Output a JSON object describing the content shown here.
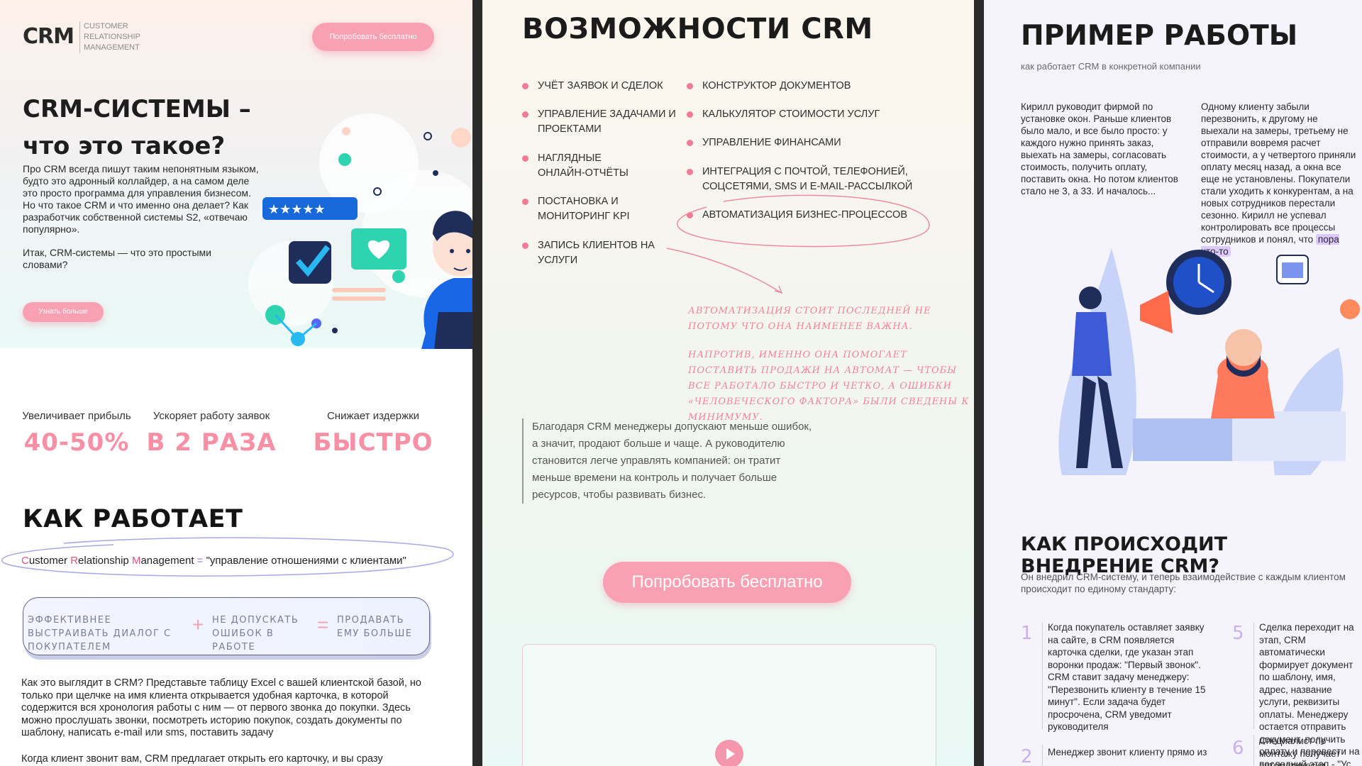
{
  "panel1": {
    "logo": "CRM",
    "logo_sub": "CUSTOMER RELATIONSHIP MANAGEMENT",
    "header_button": "Попробовать бесплатно",
    "hero_title_line1": "CRM-СИСТЕМЫ –",
    "hero_title_line2": "что это такое?",
    "intro": "Про CRM всегда пишут таким непонятным языком, будто это адронный коллайдер, а на самом деле это просто программа для управления бизнесом. Но что такое CRM и что именно она делает? Как разработчик собственной системы S2, «отвечаю популярно».",
    "intro2": "Итак, CRM-системы — что это простыми словами?",
    "more_button": "Узнать больше",
    "stats": [
      {
        "label": "Увеличивает прибыль",
        "value": "40-50%"
      },
      {
        "label": "Ускоряет работу заявок",
        "value": "В 2 РАЗА"
      },
      {
        "label": "Снижает издержки",
        "value": "БЫСТРО"
      }
    ],
    "how_title": "КАК РАБОТАЕТ",
    "crm_def": {
      "c": "C",
      "c_rest": "ustomer ",
      "r": "R",
      "r_rest": "elationship ",
      "m": "M",
      "m_rest": "anagement",
      "eq": " = ",
      "meaning": "\"управление отношениями с клиентами\""
    },
    "formula": {
      "a": "ЭФФЕКТИВНЕЕ ВЫСТРАИВАТЬ ДИАЛОГ С ПОКУПАТЕЛЕМ",
      "plus": "+",
      "b": "НЕ ДОПУСКАТЬ ОШИБОК В РАБОТЕ",
      "eq": "=",
      "c": "ПРОДАВАТЬ ЕМУ БОЛЬШЕ"
    },
    "para1": "Как это выглядит в CRM? Представьте таблицу Excel с вашей клиентской базой, но только при щелчке на имя клиента открывается удобная карточка, в которой содержится вся хронология работы с ним — от первого звонка до покупки. Здесь можно прослушать звонки, посмотреть историю покупок, создать документы по шаблону, написать e-mail или sms, поставить задачу",
    "para2": "Когда клиент звонит вам, CRM предлагает открыть его карточку, и вы сразу"
  },
  "panel2": {
    "title": "ВОЗМОЖНОСТИ CRM",
    "features_left": [
      "УЧЁТ ЗАЯВОК И СДЕЛОК",
      "УПРАВЛЕНИЕ ЗАДАЧАМИ И ПРОЕКТАМИ",
      "НАГЛЯДНЫЕ ОНЛАЙН-ОТЧЁТЫ",
      "ПОСТАНОВКА И МОНИТОРИНГ KPI",
      "ЗАПИСЬ КЛИЕНТОВ НА УСЛУГИ"
    ],
    "features_right": [
      "КОНСТРУКТОР ДОКУМЕНТОВ",
      "КАЛЬКУЛЯТОР СТОИМОСТИ УСЛУГ",
      "УПРАВЛЕНИЕ ФИНАНСАМИ",
      "ИНТЕГРАЦИЯ С ПОЧТОЙ, ТЕЛЕФОНИЕЙ, СОЦСЕТЯМИ, SMS И E-MAIL-РАССЫЛКОЙ",
      "АВТОМАТИЗАЦИЯ БИЗНЕС-ПРОЦЕССОВ"
    ],
    "note1": "Автоматизация стоит последней не потому что она наименее важна.",
    "note2": "Напротив, именно она помогает поставить продажи на автомат — чтобы все работало быстро и четко, а ошибки «человеческого фактора» были сведены к минимуму.",
    "quote": "Благодаря CRM менеджеры допускают меньше ошибок, а значит, продают больше и чаще. А руководителю становится легче управлять компанией: он тратит меньше времени на контроль и получает больше ресурсов, чтобы развивать бизнес.",
    "try_button": "Попробовать бесплатно"
  },
  "panel3": {
    "title": "ПРИМЕР РАБОТЫ",
    "subtitle": "как работает CRM в конкретной компании",
    "case1": "Кирилл руководит фирмой по установке окон. Раньше клиентов было мало, и все было просто: у каждого нужно принять заказ, выехать на замеры, согласовать стоимость, получить оплату, поставить окна. Но потом клиентов стало не 3, а 33. И началось...",
    "case2": "Одному клиенту забыли перезвонить, к другому не выехали на замеры, третьему не отправили вовремя расчет стоимости, а у четвертого приняли оплату месяц назад, а окна все еще не установлены. Покупатели стали уходить к конкурентам, а на новых сотрудников перестали сезонно. Кирилл не успевал контролировать все процессы сотрудников и понял, что",
    "case2_highlight": "пора что-то",
    "impl_title": "КАК ПРОИСХОДИТ ВНЕДРЕНИЕ CRM?",
    "impl_sub": "Он внедрил CRM-систему, и теперь взаимодействие с каждым клиентом происходит по единому стандарту:",
    "steps": [
      {
        "num": "1",
        "text": "Когда покупатель оставляет заявку на сайте, в CRM появляется карточка сделки, где указан этап воронки продаж: \"Первый звонок\". CRM ставит задачу менеджеру: \"Перезвонить клиенту в течение 15 минут\". Если задача будет просрочена, CRM уведомит руководителя"
      },
      {
        "num": "2",
        "text": "Менеджер звонит клиенту прямо из"
      },
      {
        "num": "5",
        "text": "Сделка переходит на этап, CRM автоматически формирует документ по шаблону, имя, адрес, название услуги, реквизиты оплаты. Менеджеру остается отправить документ, получить оплату и перевести на последний этап - \"Ус"
      },
      {
        "num": "6",
        "text": "Специалист по монтажу получает автоматически"
      }
    ]
  }
}
